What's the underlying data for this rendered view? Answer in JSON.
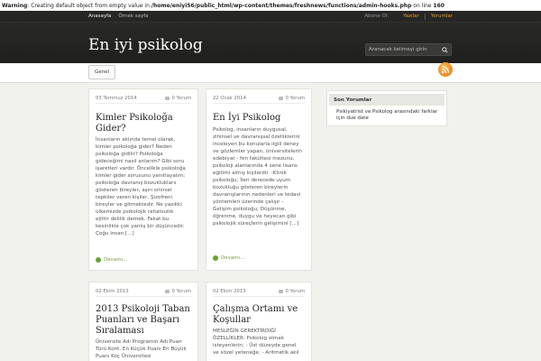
{
  "warning": {
    "label": "Warning",
    "text": ": Creating default object from empty value in ",
    "path": "/home/eniyi56/public_html/wp-content/themes/freshnews/functions/admin-hooks.php",
    "line_text": " on line ",
    "line_no": "160"
  },
  "topnav": {
    "left": [
      "Anasayfa",
      "Örnek sayfa"
    ],
    "right": [
      "Abone Ol:",
      "Yazılar",
      "Yorumlar"
    ]
  },
  "site": {
    "title": "En iyi psikolog"
  },
  "search": {
    "placeholder": "Aranacak kelimeyi girin"
  },
  "menu": {
    "tab": "Genel"
  },
  "posts": [
    {
      "date": "03 Temmuz 2014",
      "comments": "0 Yorum",
      "title": "Kimler Psikoloğa Gider?",
      "excerpt": "İnsanların aklında temel olarak, kimler psikoloğa gider? Neden psikoloğa gidilir? Psikoloğa gideceğimi nasıl anlarım? Gibi soru işaretleri vardır. Öncelikle psikoloğa kimler gider sorusunu yanıtlayalım; psikoloğa davranış bozukluklarıı gösteren bireyler, aşırı sinirsel tepkiler veren kişiler, Şizofreni bireyler ve gitmektedir. Ne yazıkki ülkemizde psikolojik rahatsızlık ejittir delilik demek. Fakat bu kesinlikle çok yanlış bir düşüncedir. Çoğu insan [...]",
      "more": "Devamı..."
    },
    {
      "date": "22 Ocak 2014",
      "comments": "0 Yorum",
      "title": "En İyi Psikolog",
      "excerpt": "Psikolog, insanların duygusal, zihinsel ve davranışsal özelliklerini inceleyen bu konularla ilgili deney ve gözlemler yapan, üniversitelerin edebiyat - fen fakültesi mezunu, psikoloji alanlarında 4 sene lisans eğitimi almış kişilerdir. -Klinik psikoloğu; İleri derecede uyum bozukluğu gösteren bireylerin davranışlarının nedenleri ve tedavi yöntemleri üzerinde çalışır -Gelişim psikoloğu; Düşünme, öğrenme, duygu ve heyecan gibi psikolojik süreçlerin gelişimini [...]",
      "more": "Devamı..."
    },
    {
      "date": "02 Ekim 2013",
      "comments": "0 Yorum",
      "title": "2013 Psikoloji Taban Puanları ve Başarı Sıralaması",
      "excerpt": "Üniversite Adı Programın Adı Puan Türü Kont. En Küçük Puanı En Büyük Puanı Koç Üniversitesi",
      "more": ""
    },
    {
      "date": "02 Ekim 2013",
      "comments": "0 Yorum",
      "title": "Çalışma Ortamı ve Koşullar",
      "excerpt": "MESLEĞİN GEREKTİRDİĞİ ÖZELLİKLER: Psikolog olmak isteyenlerin; - Üst düzeyde genel ve sözel yeteneğe, - Aritmetik akıl",
      "more": ""
    }
  ],
  "sidebar": {
    "title": "Son Yorumlar",
    "items": [
      "Psikiyatrist ve Psikolog arasındaki farklar için due date"
    ]
  },
  "colors": {
    "header": "#262624",
    "accent": "#e9a126",
    "more": "#7a9a3a",
    "rss": "#e4740c"
  },
  "icons": {
    "search": "search-icon",
    "rss": "rss-icon",
    "comment": "comment-icon",
    "more": "arrow-circle-icon"
  }
}
